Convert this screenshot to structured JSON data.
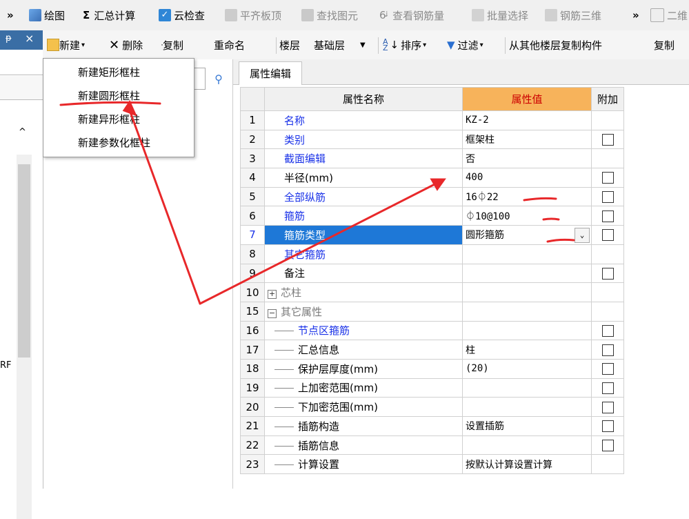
{
  "toolbar1": {
    "overflow": "»",
    "draw": "绘图",
    "sum_calc": "汇总计算",
    "cloud_check": "云检查",
    "flush_slab": "平齐板顶",
    "find_elem": "查找图元",
    "view_rebar": "查看钢筋量",
    "batch_select": "批量选择",
    "rebar_3d": "钢筋三维",
    "overflow2": "»",
    "view_2d": "二维"
  },
  "left_panel": {
    "pin": "ᵽ",
    "close": "×",
    "side_text": "RF"
  },
  "toolbar2": {
    "new": "新建",
    "delete": "删除",
    "copy": "复制",
    "rename": "重命名",
    "floor_label": "楼层",
    "floor_value": "基础层",
    "sort": "排序",
    "filter": "过滤",
    "copy_from_floor": "从其他楼层复制构件",
    "copy_more": "复制"
  },
  "new_menu": [
    "新建矩形框柱",
    "新建圆形框柱",
    "新建异形框柱",
    "新建参数化框柱"
  ],
  "prop_panel": {
    "tab": "属性编辑",
    "headers": {
      "name": "属性名称",
      "value": "属性值",
      "extra": "附加"
    },
    "rows": [
      {
        "no": "1",
        "name": "名称",
        "value": "KZ-2",
        "check": false
      },
      {
        "no": "2",
        "name": "类别",
        "value": "框架柱",
        "check": true
      },
      {
        "no": "3",
        "name": "截面编辑",
        "value": "否",
        "check": false
      },
      {
        "no": "4",
        "name": "半径(mm)",
        "value": "400",
        "check": true
      },
      {
        "no": "5",
        "name": "全部纵筋",
        "value": "16⏀22",
        "check": true
      },
      {
        "no": "6",
        "name": "箍筋",
        "value": "⏀10@100",
        "check": true
      },
      {
        "no": "7",
        "name": "箍筋类型",
        "value": "圆形箍筋",
        "check": true
      },
      {
        "no": "8",
        "name": "其它箍筋",
        "value": "",
        "check": false
      },
      {
        "no": "9",
        "name": "备注",
        "value": "",
        "check": true
      },
      {
        "no": "10",
        "name": "芯柱",
        "value": "",
        "check": false
      },
      {
        "no": "15",
        "name": "其它属性",
        "value": "",
        "check": false
      },
      {
        "no": "16",
        "name": "节点区箍筋",
        "value": "",
        "check": true
      },
      {
        "no": "17",
        "name": "汇总信息",
        "value": "柱",
        "check": true
      },
      {
        "no": "18",
        "name": "保护层厚度(mm)",
        "value": "(20)",
        "check": true
      },
      {
        "no": "19",
        "name": "上加密范围(mm)",
        "value": "",
        "check": true
      },
      {
        "no": "20",
        "name": "下加密范围(mm)",
        "value": "",
        "check": true
      },
      {
        "no": "21",
        "name": "插筋构造",
        "value": "设置插筋",
        "check": true
      },
      {
        "no": "22",
        "name": "插筋信息",
        "value": "",
        "check": true
      },
      {
        "no": "23",
        "name": "计算设置",
        "value": "按默认计算设置计算",
        "check": false
      }
    ]
  },
  "colors": {
    "highlight_row": "#1e78d7",
    "header_value_bg": "#f7b35b",
    "link_blue": "#1a32e8",
    "annotation_red": "#e8282a"
  }
}
